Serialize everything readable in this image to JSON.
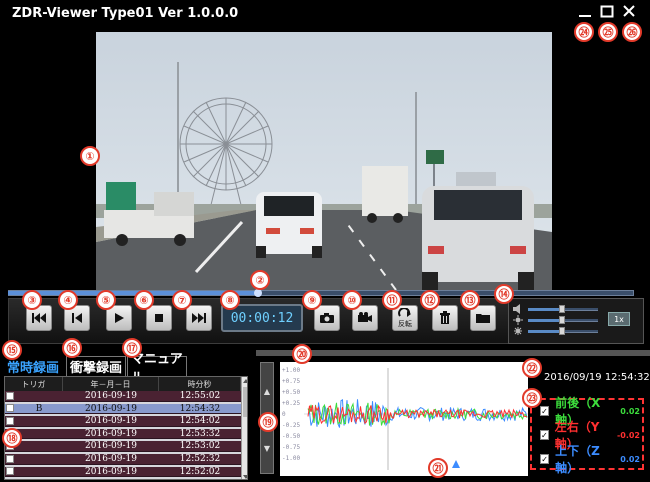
{
  "app_title": "ZDR-Viewer Type01 Ver 1.0.0.0",
  "window": {
    "minimize_icon": "minimize-icon",
    "maximize_icon": "maximize-icon",
    "close_icon": "close-icon"
  },
  "player": {
    "progress": 0.4,
    "time": "00:00:12",
    "flip_label": "反転",
    "buttons": [
      "skip-back-icon",
      "prev-frame-icon",
      "play-icon",
      "stop-icon",
      "skip-forward-icon",
      "camera-icon",
      "video-record-icon",
      "flip-icon",
      "trash-icon",
      "folder-icon"
    ]
  },
  "sliders": {
    "volume": 0.48,
    "brightness": 0.48,
    "contrast": 0.48,
    "speed_label": "1x"
  },
  "tabs": [
    {
      "label": "常時録画",
      "active": true
    },
    {
      "label": "衝撃録画",
      "active": false
    },
    {
      "label": "マニュアル",
      "active": false
    }
  ],
  "file_table": {
    "headers": [
      "トリガ",
      "年－月－日",
      "時分秒"
    ],
    "rows": [
      {
        "trigger": "",
        "date": "2016-09-19",
        "time": "12:55:02",
        "selected": false
      },
      {
        "trigger": "B",
        "date": "2016-09-19",
        "time": "12:54:32",
        "selected": true
      },
      {
        "trigger": "",
        "date": "2016-09-19",
        "time": "12:54:02",
        "selected": false
      },
      {
        "trigger": "",
        "date": "2016-09-19",
        "time": "12:53:32",
        "selected": false
      },
      {
        "trigger": "",
        "date": "2016-09-19",
        "time": "12:53:02",
        "selected": false
      },
      {
        "trigger": "",
        "date": "2016-09-19",
        "time": "12:52:32",
        "selected": false
      },
      {
        "trigger": "",
        "date": "2016-09-19",
        "time": "12:52:02",
        "selected": false
      }
    ]
  },
  "graph": {
    "yticks": [
      "+1.00",
      "+0.75",
      "+0.50",
      "+0.25",
      "0",
      "-0.25",
      "-0.50",
      "-0.75",
      "-1.00"
    ],
    "datetime": "2016/09/19 12:54:32"
  },
  "axes": [
    {
      "label": "前後（X軸）",
      "value": "0.02",
      "color": "#3cdc3c"
    },
    {
      "label": "左右（Y軸）",
      "value": "-0.02",
      "color": "#ff3030"
    },
    {
      "label": "上下（Z軸）",
      "value": "0.02",
      "color": "#3c8cff"
    }
  ],
  "callouts": [
    "①",
    "②",
    "③",
    "④",
    "⑤",
    "⑥",
    "⑦",
    "⑧",
    "⑨",
    "⑩",
    "⑪",
    "⑫",
    "⑬",
    "⑭",
    "⑮",
    "⑯",
    "⑰",
    "⑱",
    "⑲",
    "⑳",
    "㉑",
    "㉒",
    "㉓",
    "㉔",
    "㉕",
    "㉖"
  ],
  "colors": {
    "accent_blue": "#3aa3ff",
    "callout_red": "#e23a2a",
    "selected_row": "#8899cc",
    "row_bg": "#4a2232"
  }
}
